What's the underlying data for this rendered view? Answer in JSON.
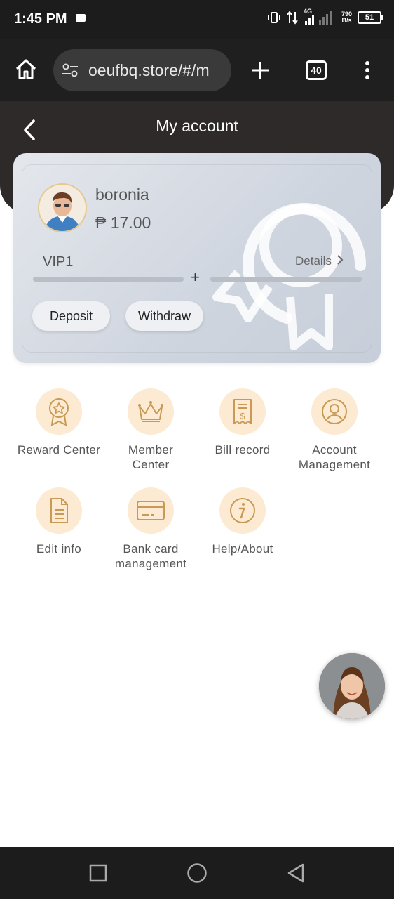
{
  "status": {
    "time": "1:45 PM",
    "network": "4G",
    "netspeed_value": "790",
    "netspeed_unit": "B/s",
    "battery": "51"
  },
  "browser": {
    "url": "oeufbq.store/#/m",
    "tab_count": "40"
  },
  "header": {
    "title": "My account"
  },
  "account": {
    "username": "boronia",
    "balance": "₱ 17.00",
    "vip_level": "VIP1",
    "details_label": "Details",
    "plus": "+",
    "deposit_label": "Deposit",
    "withdraw_label": "Withdraw"
  },
  "menu": {
    "items": [
      {
        "label": "Reward Center",
        "icon": "reward-icon"
      },
      {
        "label": "Member\nCenter",
        "icon": "crown-icon"
      },
      {
        "label": "Bill record",
        "icon": "bill-icon"
      },
      {
        "label": "Account\nManagement",
        "icon": "user-icon"
      },
      {
        "label": "Edit info",
        "icon": "document-icon"
      },
      {
        "label": "Bank card\nmanagement",
        "icon": "card-icon"
      },
      {
        "label": "Help/About",
        "icon": "info-icon"
      }
    ]
  },
  "colors": {
    "accent": "#c89a55",
    "icon_bg": "#fcebd2",
    "header_bg": "#2f2a2a"
  }
}
